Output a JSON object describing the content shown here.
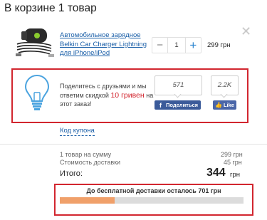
{
  "cart": {
    "title": "В корзине 1 товар",
    "close_icon": "close-icon"
  },
  "item": {
    "name": "Автомобильное зарядное Belkin Car Charger Lightning для iPhone/iPod",
    "image_icon": "car-charger-image",
    "quantity": "1",
    "minus_label": "−",
    "plus_label": "+",
    "price": "299 грн"
  },
  "promo": {
    "icon": "lightbulb-icon",
    "text_before": "Поделитесь с друзьями и мы ответим скидкой",
    "discount": "10 гривен",
    "text_after": "на этот заказ!",
    "accent_color": "#d2262f"
  },
  "facebook": {
    "share_count": "571",
    "share_label": "Поделиться",
    "like_count": "2.2K",
    "like_label": "Like",
    "brand_color": "#3b5b9a"
  },
  "coupon": {
    "label": "Код купона"
  },
  "summary": {
    "items_label": "1 товар на сумму",
    "items_value": "299 грн",
    "shipping_label": "Стоимость доставки",
    "shipping_value": "45 грн",
    "total_label": "Итого:",
    "total_value": "344",
    "currency": "грн"
  },
  "delivery": {
    "text": "До бесплатной доставки осталось 701 грн",
    "progress": 0.3,
    "fill_color": "#f0a06a"
  }
}
